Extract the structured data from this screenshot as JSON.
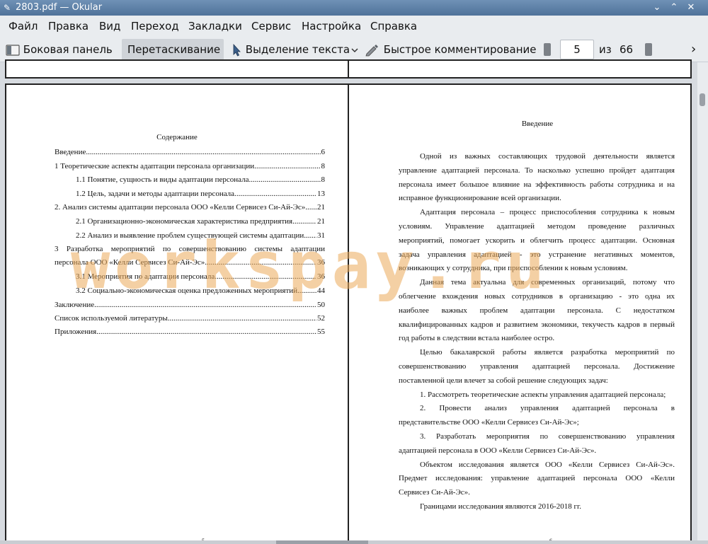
{
  "window": {
    "title": "2803.pdf — Okular",
    "controls": [
      "⌄",
      "⌃",
      "✕"
    ]
  },
  "menu": [
    "Файл",
    "Правка",
    "Вид",
    "Переход",
    "Закладки",
    "Сервис",
    "Настройка",
    "Справка"
  ],
  "toolbar": {
    "sidebar_label": "Боковая панель",
    "drag_label": "Перетаскивание",
    "select_label": "Выделение текста",
    "annotate_label": "Быстрое комментирование",
    "page_current": "5",
    "page_of": "из",
    "page_total": "66",
    "next_label": "›"
  },
  "left_page": {
    "heading": "Содержание",
    "toc": [
      {
        "text": "Введение",
        "page": "6"
      },
      {
        "text": "1 Теоретические аспекты адаптации персонала организации",
        "page": "8"
      },
      {
        "text": "1.1    Понятие, сущность и виды адаптации персонала.",
        "page": "8"
      },
      {
        "text": "1.2 Цель, задачи и методы адаптации персонала.",
        "page": "13"
      },
      {
        "text": "2. Анализ системы адаптации персонала ООО «Келли Сервисез Си-Ай-Эс»",
        "page": "21"
      },
      {
        "text": "2.1 Организационно-экономическая характеристика предприятия",
        "page": "21"
      },
      {
        "text": "2.2    Анализ и выявление проблем существующей системы адаптации",
        "page": "31"
      },
      {
        "text": "3 Разработка мероприятий по совершенствованию системы адаптации",
        "page": ""
      },
      {
        "text": "персонала ООО «Келли Сервисез Си-Ай-Эс»",
        "page": "36"
      },
      {
        "text": "3.1 Мероприятия по адаптации персонала",
        "page": "36"
      },
      {
        "text": "3.2 Социально-экономическая оценка предложенных мероприятий",
        "page": "44"
      },
      {
        "text": "Заключение",
        "page": "50"
      },
      {
        "text": "Список используемой литературы",
        "page": "52"
      },
      {
        "text": "Приложения",
        "page": "55"
      }
    ],
    "footer": "5"
  },
  "right_page": {
    "heading": "Введение",
    "lines": [
      {
        "text": "Одной из важных составляющих трудовой деятельности является",
        "j": true
      },
      {
        "text": "управление адаптацией персонала. То насколько успешно пройдет адаптация",
        "j": true
      },
      {
        "text": "персонала имеет большое влияние на эффективность работы сотрудника и на",
        "j": true
      },
      {
        "text": "исправное функционирование всей организации.",
        "j": false
      },
      {
        "text": "Адаптация персонала – процесс приспособления сотрудника к новым",
        "j": true
      },
      {
        "text": "условиям.   Управление адаптацией методом проведение различных",
        "j": true
      },
      {
        "text": "мероприятий, помогает ускорить и облегчить процесс адаптации. Основная",
        "j": true
      },
      {
        "text": "задача управления адаптацией - это устранение негативных моментов,",
        "j": true
      },
      {
        "text": "возникающих у сотрудника, при приспособлении к новым условиям.",
        "j": false
      },
      {
        "text": "Данная тема актуальна для современных организаций, потому что",
        "j": true
      },
      {
        "text": "облегчение вхождения новых сотрудников в организацию - это одна их",
        "j": true
      },
      {
        "text": "наиболее важных проблем адаптации персонала. С недостатком",
        "j": true
      },
      {
        "text": "квалифицированных кадров и развитием экономики, текучесть кадров в первый",
        "j": true
      },
      {
        "text": "год работы в следствии встала наиболее остро.",
        "j": false
      },
      {
        "text": "Целью бакалаврской работы является разработка мероприятий по",
        "j": true
      },
      {
        "text": "совершенствованию управления адаптацией персонала. Достижение",
        "j": true
      },
      {
        "text": "поставленной цели влечет за собой решение следующих задач:",
        "j": false
      },
      {
        "text": "1. Рассмотреть теоретические аспекты управления адаптацией персонала;",
        "j": false
      },
      {
        "text": "2. Провести анализ управления адаптацией персонала в",
        "j": true
      },
      {
        "text": "представительстве ООО «Келли Сервисез Си-Ай-Эс»;",
        "j": false
      },
      {
        "text": "3. Разработать мероприятия по совершенствованию управления",
        "j": true
      },
      {
        "text": "адаптацией персонала в ООО «Келли Сервисез Си-Ай-Эс».",
        "j": false
      },
      {
        "text": "Объектом исследования является ООО «Келли Сервисез Си-Ай-Эс».",
        "j": true
      },
      {
        "text": "Предмет исследования: управление адаптацией персонала ООО «Келли",
        "j": true
      },
      {
        "text": "Сервисез Си-Ай-Эс».",
        "j": false
      },
      {
        "text": "Границами исследования являются 2016-2018 гг.",
        "j": false
      }
    ],
    "footer": "6"
  },
  "watermark": "workspay.ru",
  "colors": {
    "titlebar": "#5a7ea6",
    "watermark": "#ebaa5a",
    "active_button": "#cfd3d8"
  }
}
